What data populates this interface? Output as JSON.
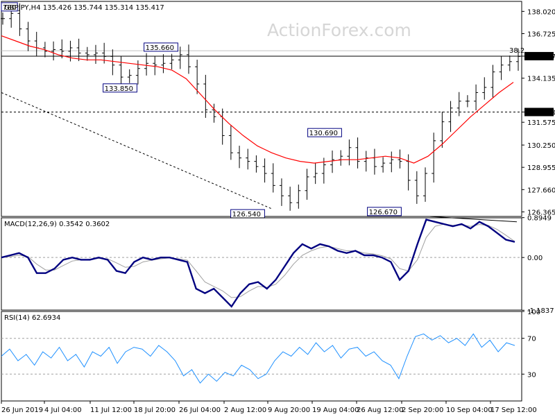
{
  "watermark": "ActionForex.com",
  "chart_data": [
    {
      "type": "candlestick",
      "title": "GBPJPY,H4 135.426 135.744 135.314 135.417",
      "symbol": "GBPJPY",
      "timeframe": "H4",
      "ohlc_last": {
        "open": 135.426,
        "high": 135.744,
        "low": 135.314,
        "close": 135.417
      },
      "ylim": [
        126.1,
        138.6
      ],
      "y_ticks": [
        "138.020",
        "136.725",
        "135.417",
        "134.135",
        "132.170",
        "131.575",
        "130.250",
        "128.955",
        "127.660",
        "126.365"
      ],
      "x_ticks": [
        "26 Jun 2019",
        "4 Jul 04:00",
        "11 Jul 12:00",
        "18 Jul 20:00",
        "26 Jul 04:00",
        "2 Aug 12:00",
        "9 Aug 20:00",
        "19 Aug 04:00",
        "26 Aug 12:00",
        "2 Sep 20:00",
        "10 Sep 04:00",
        "17 Sep 12:00"
      ],
      "close_series": [
        137.6,
        137.9,
        137.0,
        136.3,
        135.9,
        135.7,
        135.8,
        135.7,
        135.9,
        135.6,
        135.5,
        135.6,
        135.4,
        134.9,
        134.2,
        134.3,
        134.7,
        135.0,
        134.9,
        135.0,
        135.2,
        135.5,
        134.8,
        133.8,
        132.3,
        131.9,
        130.8,
        129.8,
        129.5,
        129.3,
        129.0,
        128.6,
        127.9,
        127.3,
        126.9,
        127.6,
        128.4,
        128.6,
        129.1,
        129.4,
        129.6,
        130.1,
        129.3,
        129.5,
        129.0,
        129.2,
        129.4,
        129.3,
        128.2,
        127.3,
        128.6,
        130.5,
        131.6,
        132.4,
        132.8,
        132.8,
        133.3,
        133.6,
        134.5,
        134.9,
        135.1,
        135.4
      ],
      "moving_average": [
        136.6,
        136.3,
        136.0,
        135.8,
        135.5,
        135.3,
        135.2,
        135.2,
        135.1,
        135.0,
        134.9,
        134.8,
        134.6,
        134.1,
        133.2,
        132.3,
        131.5,
        130.8,
        130.2,
        129.8,
        129.5,
        129.3,
        129.2,
        129.3,
        129.4,
        129.4,
        129.5,
        129.6,
        129.5,
        129.2,
        129.6,
        130.3,
        131.1,
        131.9,
        132.6,
        133.3,
        133.9
      ],
      "ma_color": "#ff0000",
      "candle_color": "#000000",
      "labels": [
        {
          "text": "780",
          "value": 138.0
        },
        {
          "text": "135.660",
          "value": 135.66
        },
        {
          "text": "133.850",
          "value": 133.85
        },
        {
          "text": "126.540",
          "value": 126.54
        },
        {
          "text": "130.690",
          "value": 130.69
        },
        {
          "text": "126.670",
          "value": 126.67
        }
      ],
      "horizontal_lines": [
        {
          "value": 135.417,
          "label": "135.417",
          "style": "solid",
          "color": "#000000"
        },
        {
          "value": 132.17,
          "label": "132.170",
          "style": "dashed",
          "color": "#000000"
        },
        {
          "value": 135.73,
          "label": "38.2",
          "style": "solid",
          "color": "#c0c0c0"
        }
      ],
      "trendline": {
        "style": "dashed",
        "from": {
          "x": "26 Jun 2019",
          "y": 133.3
        },
        "to": {
          "x": "9 Aug 20:00",
          "y": 126.54
        }
      }
    },
    {
      "type": "line",
      "title": "MACD(12,26,9) 0.3542 0.3602",
      "indicator": "MACD(12,26,9)",
      "macd_value": 0.3542,
      "signal_value": 0.3602,
      "y_ticks": [
        "0.8949",
        "0.00",
        "-1.1837"
      ],
      "ylim": [
        -1.18,
        0.89
      ],
      "macd_series": [
        0.0,
        0.05,
        0.1,
        0.0,
        -0.35,
        -0.35,
        -0.25,
        -0.05,
        0.0,
        -0.05,
        -0.05,
        0.0,
        -0.05,
        -0.3,
        -0.35,
        -0.1,
        0.0,
        -0.05,
        0.0,
        0.0,
        -0.05,
        -0.1,
        -0.7,
        -0.8,
        -0.7,
        -0.9,
        -1.1,
        -0.8,
        -0.6,
        -0.55,
        -0.7,
        -0.5,
        -0.2,
        0.1,
        0.3,
        0.2,
        0.3,
        0.25,
        0.15,
        0.1,
        0.15,
        0.05,
        0.05,
        0.0,
        -0.1,
        -0.5,
        -0.3,
        0.3,
        0.85,
        0.8,
        0.75,
        0.7,
        0.75,
        0.65,
        0.8,
        0.7,
        0.55,
        0.4,
        0.35
      ],
      "signal_series": [
        0.0,
        0.02,
        0.05,
        0.02,
        -0.15,
        -0.28,
        -0.28,
        -0.18,
        -0.08,
        -0.05,
        -0.04,
        -0.02,
        -0.03,
        -0.12,
        -0.22,
        -0.2,
        -0.1,
        -0.06,
        -0.03,
        -0.01,
        -0.03,
        -0.06,
        -0.3,
        -0.55,
        -0.65,
        -0.75,
        -0.9,
        -0.88,
        -0.75,
        -0.65,
        -0.67,
        -0.6,
        -0.4,
        -0.15,
        0.05,
        0.15,
        0.22,
        0.25,
        0.2,
        0.15,
        0.15,
        0.1,
        0.08,
        0.04,
        -0.03,
        -0.25,
        -0.3,
        -0.05,
        0.45,
        0.7,
        0.75,
        0.72,
        0.73,
        0.7,
        0.74,
        0.72,
        0.63,
        0.5,
        0.36
      ],
      "macd_color": "#000080",
      "signal_color": "#a0a0a0",
      "divergence_line": {
        "from": 0.92,
        "to": 0.8,
        "color": "#000000"
      }
    },
    {
      "type": "line",
      "title": "RSI(14) 62.6934",
      "indicator": "RSI(14)",
      "rsi_value": 62.6934,
      "y_ticks": [
        "100",
        "70",
        "30",
        "0"
      ],
      "ylim": [
        0,
        100
      ],
      "levels": [
        70,
        30
      ],
      "rsi_series": [
        50,
        58,
        45,
        52,
        40,
        55,
        48,
        60,
        45,
        52,
        38,
        55,
        50,
        60,
        42,
        55,
        60,
        58,
        50,
        62,
        55,
        45,
        28,
        35,
        20,
        30,
        22,
        32,
        28,
        40,
        35,
        25,
        30,
        45,
        55,
        50,
        60,
        52,
        65,
        55,
        62,
        48,
        58,
        60,
        50,
        55,
        45,
        40,
        25,
        50,
        72,
        75,
        68,
        73,
        65,
        70,
        62,
        75,
        60,
        68,
        55,
        65,
        62
      ],
      "line_color": "#1e90ff"
    }
  ]
}
